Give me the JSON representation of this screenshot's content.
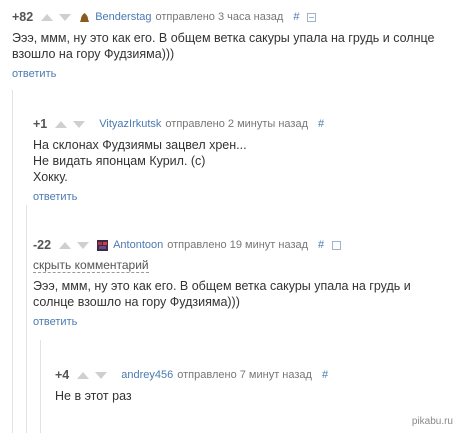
{
  "comments": [
    {
      "rating": "+82",
      "author": "Benderstag",
      "posted": "отправлено 3 часа назад",
      "hash": "#",
      "text": "Эээ, ммм, ну это как его. В общем ветка сакуры упала на грудь и солнце\nвзошло на гору Фудзияма)))",
      "reply": "ответить"
    },
    {
      "rating": "+1",
      "author": "VityazIrkutsk",
      "posted": "отправлено 2 минуты назад",
      "hash": "#",
      "text": "На склонах Фудзиямы зацвел хрен...\nНе видать японцам Курил. (с)\nХокку.",
      "reply": "ответить"
    },
    {
      "rating": "-22",
      "author": "Antontoon",
      "posted": "отправлено 19 минут назад",
      "hash": "#",
      "hide": "скрыть комментарий",
      "text": "Эээ, ммм, ну это как его. В общем ветка сакуры упала на грудь и\nсолнце взошло на гору Фудзияма)))",
      "reply": "ответить"
    },
    {
      "rating": "+4",
      "author": "andrey456",
      "posted": "отправлено 7 минут назад",
      "hash": "#",
      "text": "Не в этот раз"
    }
  ],
  "watermark": "pikabu.ru"
}
